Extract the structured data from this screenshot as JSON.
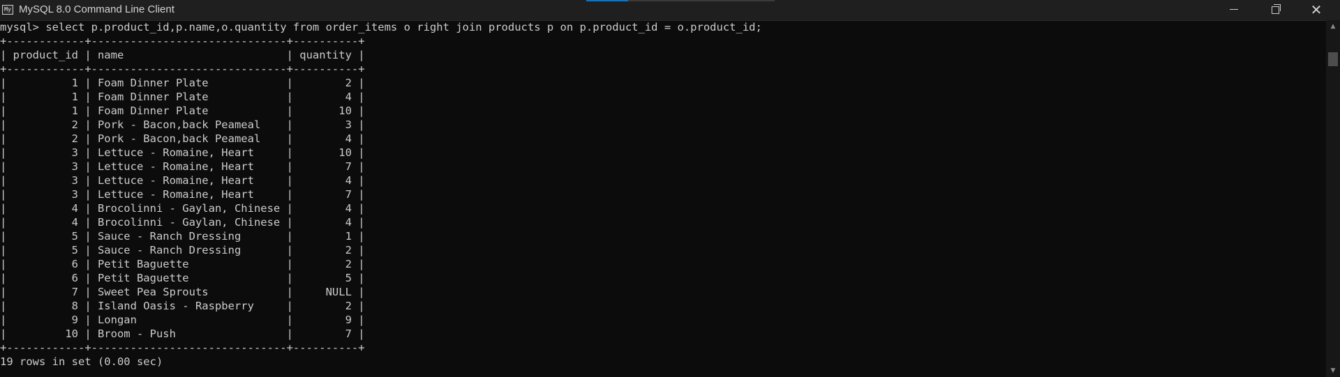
{
  "window": {
    "title": "MySQL 8.0 Command Line Client",
    "icon": "mysql-console-icon",
    "icon_text": "My"
  },
  "controls": {
    "minimize_icon": "minimize-icon",
    "maximize_icon": "restore-icon",
    "close_icon": "close-icon",
    "close_glyph": "✕"
  },
  "console": {
    "lines": [
      "mysql> select p.product_id,p.name,o.quantity from order_items o right join products p on p.product_id = o.product_id;",
      "+------------+------------------------------+----------+",
      "| product_id | name                         | quantity |",
      "+------------+------------------------------+----------+",
      "|          1 | Foam Dinner Plate            |        2 |",
      "|          1 | Foam Dinner Plate            |        4 |",
      "|          1 | Foam Dinner Plate            |       10 |",
      "|          2 | Pork - Bacon,back Peameal    |        3 |",
      "|          2 | Pork - Bacon,back Peameal    |        4 |",
      "|          3 | Lettuce - Romaine, Heart     |       10 |",
      "|          3 | Lettuce - Romaine, Heart     |        7 |",
      "|          3 | Lettuce - Romaine, Heart     |        4 |",
      "|          3 | Lettuce - Romaine, Heart     |        7 |",
      "|          4 | Brocolinni - Gaylan, Chinese |        4 |",
      "|          4 | Brocolinni - Gaylan, Chinese |        4 |",
      "|          5 | Sauce - Ranch Dressing       |        1 |",
      "|          5 | Sauce - Ranch Dressing       |        2 |",
      "|          6 | Petit Baguette               |        2 |",
      "|          6 | Petit Baguette               |        5 |",
      "|          7 | Sweet Pea Sprouts            |     NULL |",
      "|          8 | Island Oasis - Raspberry     |        2 |",
      "|          9 | Longan                       |        9 |",
      "|         10 | Broom - Push                 |        7 |",
      "+------------+------------------------------+----------+",
      "19 rows in set (0.00 sec)"
    ]
  },
  "scrollbar": {
    "up_icon": "scroll-up-arrow-icon",
    "down_icon": "scroll-down-arrow-icon",
    "up_glyph": "▲",
    "down_glyph": "▼"
  },
  "colors": {
    "background": "#0c0c0c",
    "text": "#cccccc",
    "titlebar": "#1f1f1f"
  }
}
